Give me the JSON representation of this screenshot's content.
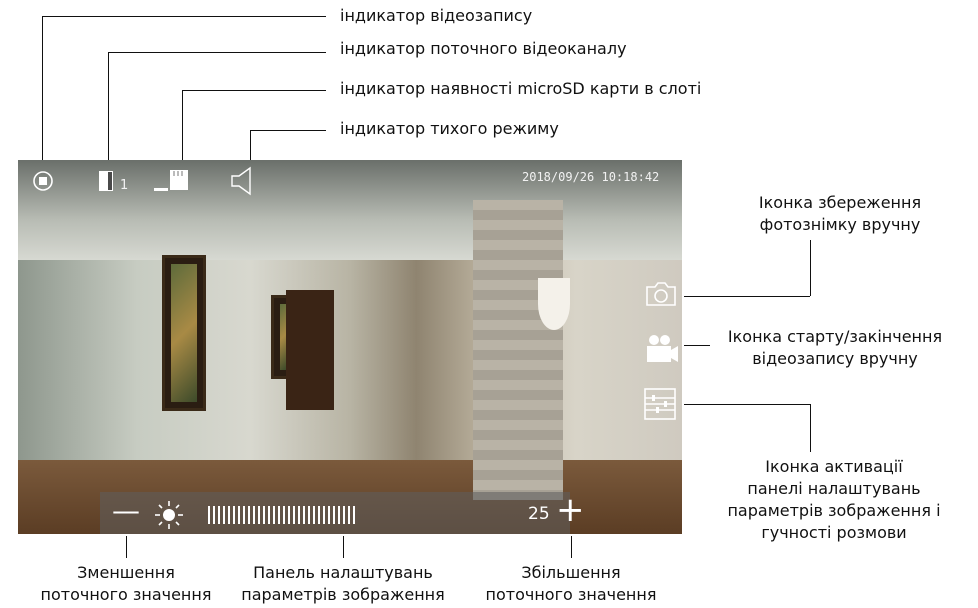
{
  "top_labels": {
    "recording": "індикатор відеозапису",
    "channel": "індикатор поточного відеоканалу",
    "sd_card": "індикатор наявності microSD карти в слоті",
    "mute": "індикатор тихого режиму"
  },
  "right_labels": {
    "snapshot": [
      "Іконка збереження",
      "фотознімку вручну"
    ],
    "record": [
      "Іконка старту/закінчення",
      "відеозапису вручну"
    ],
    "settings": [
      "Іконка активації",
      "панелі налаштувань",
      "параметрів зображення і",
      "гучності розмови"
    ]
  },
  "bottom_labels": {
    "decrease": [
      "Зменшення",
      "поточного значення"
    ],
    "panel": [
      "Панель налаштувань",
      "параметрів зображення"
    ],
    "increase": [
      "Збільшення",
      "поточного значення"
    ]
  },
  "screen": {
    "channel_number": "1",
    "datetime": "2018/09/26  10:18:42",
    "slider_value": "25",
    "minus_symbol": "—",
    "plus_symbol": "+"
  },
  "icons": {
    "recording": "record-indicator-icon",
    "channel": "door-channel-icon",
    "sd_card": "sd-card-icon",
    "mute": "speaker-mute-icon",
    "camera": "camera-icon",
    "video": "video-camera-icon",
    "settings": "sliders-settings-icon",
    "brightness": "sun-icon"
  }
}
